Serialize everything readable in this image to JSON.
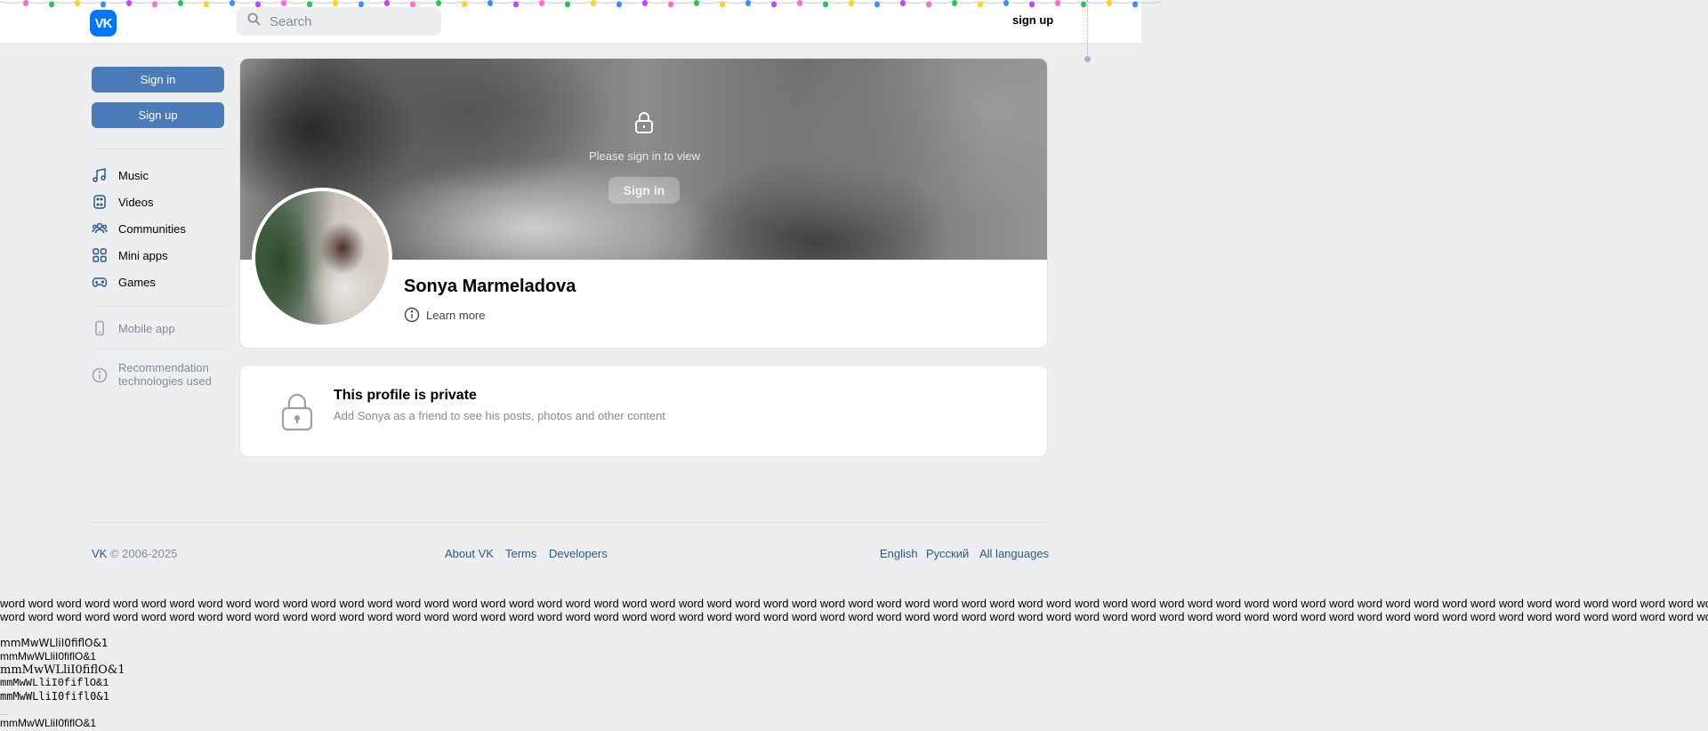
{
  "header": {
    "search_placeholder": "Search",
    "signup_label": "sign up",
    "logo_text": "VK",
    "garland_colors": [
      "#ff6ad5",
      "#29c45a",
      "#ffd21f",
      "#3b8cff",
      "#b44bff"
    ]
  },
  "sidebar": {
    "signin_label": "Sign in",
    "signup_label": "Sign up",
    "items": [
      {
        "label": "Music",
        "icon": "music-note-icon"
      },
      {
        "label": "Videos",
        "icon": "video-icon"
      },
      {
        "label": "Communities",
        "icon": "communities-icon"
      },
      {
        "label": "Mini apps",
        "icon": "mini-apps-icon"
      },
      {
        "label": "Games",
        "icon": "gamepad-icon"
      }
    ],
    "mobile_app_label": "Mobile app",
    "recommendation_label_1": "Recommendation",
    "recommendation_label_2": "technologies used"
  },
  "profile": {
    "cover_text": "Please sign in to view",
    "cover_signin_label": "Sign in",
    "name": "Sonya Marmeladova",
    "learn_more_label": "Learn more"
  },
  "private_notice": {
    "title": "This profile is private",
    "subtitle": "Add Sonya as a friend to see his posts, photos and other content"
  },
  "footer": {
    "brand": "VK",
    "copyright": "© 2006-2025",
    "links": [
      "About VK",
      "Terms",
      "Developers"
    ],
    "languages": [
      "English",
      "Русский",
      "All languages"
    ]
  },
  "test_text": {
    "words_line": "word word word word word word word word word word word word word word word word word word word word word word word word word word word word word word word word word word word word word word word word word word word word word word word word word word word word word word word word word word word word word word word word word word",
    "glyph_line": "mmMwWLliI0fiflO&1",
    "glyph_line_alt": "mmMwWLliI0fifl0&1",
    "dots": "..."
  }
}
